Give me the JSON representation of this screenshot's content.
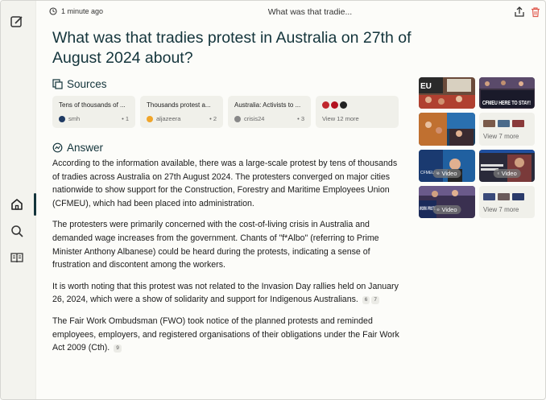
{
  "topbar": {
    "time": "1 minute ago",
    "title": "What was that tradie..."
  },
  "question": "What was that tradies protest in Australia on 27th of August 2024 about?",
  "sources": {
    "heading": "Sources",
    "items": [
      {
        "title": "Tens of thousands of ...",
        "domain": "smh",
        "num": "• 1",
        "color": "#1f3a63"
      },
      {
        "title": "Thousands protest a...",
        "domain": "aljazeera",
        "num": "• 2",
        "color": "#f0a52a"
      },
      {
        "title": "Australia: Activists to ...",
        "domain": "crisis24",
        "num": "• 3",
        "color": "#888888"
      }
    ],
    "more": "View 12 more"
  },
  "answer": {
    "heading": "Answer",
    "p1": "According to the information available, there was a large-scale protest by tens of thousands of tradies across Australia on 27th August 2024. The protesters converged on major cities nationwide to show support for the Construction, Forestry and Maritime Employees Union (CFMEU), which had been placed into administration.",
    "p2": "The protesters were primarily concerned with the cost-of-living crisis in Australia and demanded wage increases from the government. Chants of \"f*Albo\" (referring to Prime Minister Anthony Albanese) could be heard during the protests, indicating a sense of frustration and discontent among the workers.",
    "p3": "It is worth noting that this protest was not related to the Invasion Day rallies held on January 26, 2024, which were a show of solidarity and support for Indigenous Australians.",
    "p3_cites": [
      "6",
      "7"
    ],
    "p4": "The Fair Work Ombudsman (FWO) took notice of the planned protests and reminded employees, employers, and registered organisations of their obligations under the Fair Work Act 2009 (Cth).",
    "p4_cites": [
      "9"
    ]
  },
  "media": {
    "video_label": "Video",
    "view_more_1": "View 7 more",
    "view_more_2": "View 7 more",
    "image_text_1": "EU",
    "image_text_2": "CFMEU HERE TO STAY!",
    "video_text_1": "CFMEU to",
    "video_text_2": "WORK PROTE"
  },
  "colors": {
    "accent": "#13343b",
    "background": "#fcfcf9",
    "card": "#f0f0ea",
    "delete": "#e05a4e"
  }
}
